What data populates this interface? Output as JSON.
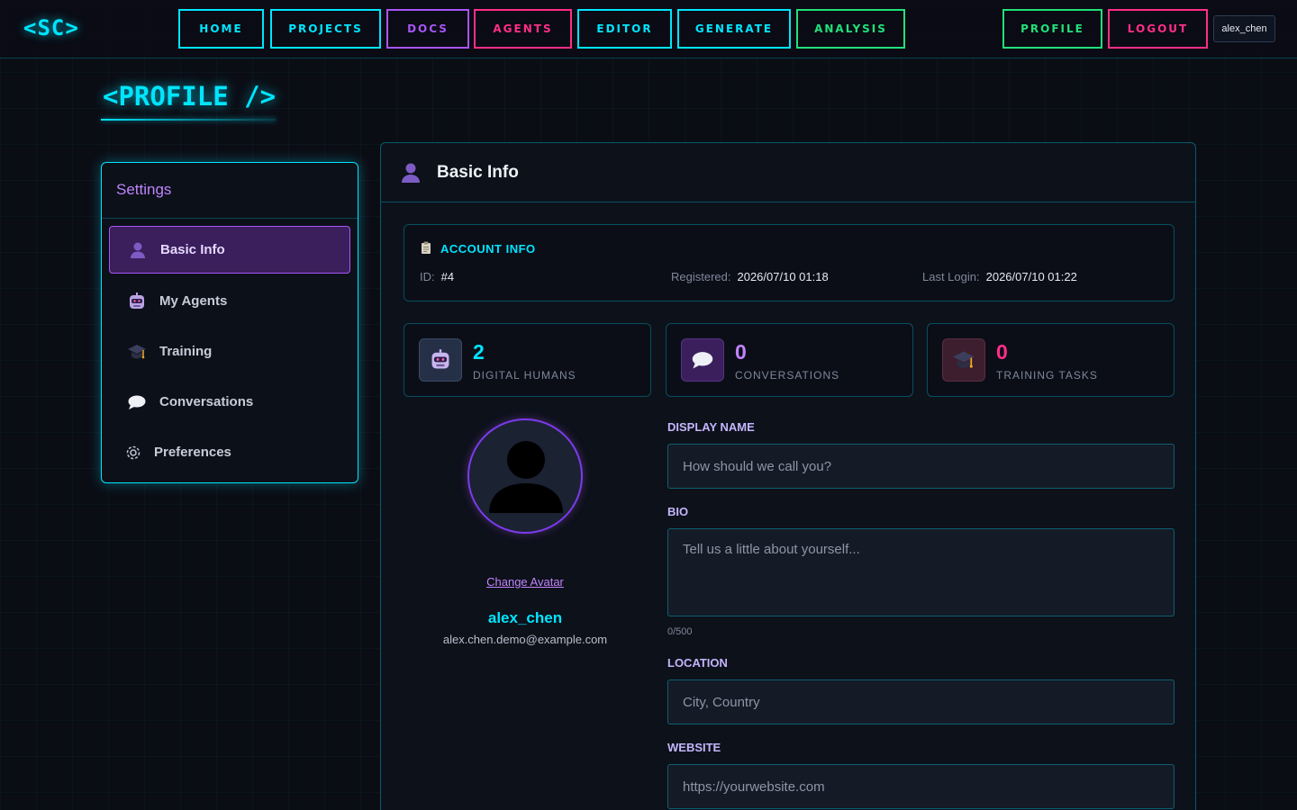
{
  "nav": {
    "logo": "<SC>",
    "items": [
      {
        "label": "HOME"
      },
      {
        "label": "PROJECTS"
      },
      {
        "label": "DOCS"
      },
      {
        "label": "AGENTS"
      },
      {
        "label": "EDITOR"
      },
      {
        "label": "GENERATE"
      },
      {
        "label": "ANALYSIS"
      }
    ],
    "profile_label": "PROFILE",
    "logout_label": "LOGOUT",
    "username": "alex_chen"
  },
  "page": {
    "title": "<PROFILE />"
  },
  "sidebar": {
    "title": "Settings",
    "items": [
      {
        "label": "Basic Info",
        "icon": "user-icon",
        "active": true
      },
      {
        "label": "My Agents",
        "icon": "robot-icon"
      },
      {
        "label": "Training",
        "icon": "graduation-cap-icon"
      },
      {
        "label": "Conversations",
        "icon": "chat-bubble-icon"
      },
      {
        "label": "Preferences",
        "icon": "gear-icon"
      }
    ]
  },
  "panel": {
    "title": "Basic Info",
    "account": {
      "heading": "ACCOUNT INFO",
      "id_label": "ID:",
      "id_value": "#4",
      "registered_label": "Registered:",
      "registered_value": "2026/07/10 01:18",
      "last_login_label": "Last Login:",
      "last_login_value": "2026/07/10 01:22"
    },
    "stats": [
      {
        "value": "2",
        "label": "DIGITAL HUMANS",
        "icon": "robot-icon",
        "color": "#00e5ff"
      },
      {
        "value": "0",
        "label": "CONVERSATIONS",
        "icon": "chat-bubble-icon",
        "color": "#c084fc"
      },
      {
        "value": "0",
        "label": "TRAINING TASKS",
        "icon": "graduation-cap-icon",
        "color": "#ff2e88"
      }
    ],
    "profile": {
      "change_avatar": "Change Avatar",
      "username": "alex_chen",
      "email": "alex.chen.demo@example.com"
    },
    "form": {
      "display_name_label": "DISPLAY NAME",
      "display_name_placeholder": "How should we call you?",
      "display_name_value": "",
      "bio_label": "BIO",
      "bio_placeholder": "Tell us a little about yourself...",
      "bio_value": "",
      "bio_counter": "0/500",
      "location_label": "LOCATION",
      "location_placeholder": "City, Country",
      "location_value": "",
      "website_label": "WEBSITE",
      "website_placeholder": "https://yourwebsite.com",
      "website_value": ""
    }
  },
  "colors": {
    "cyan": "#00e5ff",
    "purple": "#a855f7",
    "pink": "#ff2e88",
    "green": "#22e07a",
    "background": "#0b0d15"
  }
}
